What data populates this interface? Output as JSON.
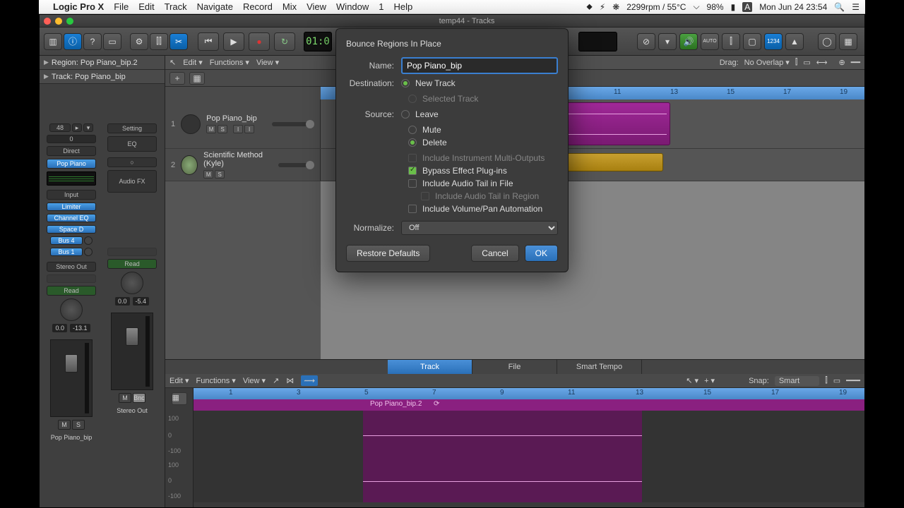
{
  "menubar": {
    "app": "Logic Pro X",
    "items": [
      "File",
      "Edit",
      "Track",
      "Navigate",
      "Record",
      "Mix",
      "View",
      "Window",
      "1",
      "Help"
    ],
    "right": {
      "temp": "2299rpm / 55°C",
      "battery": "98%",
      "date": "Mon Jun 24  23:54"
    }
  },
  "window": {
    "title": "temp44 - Tracks"
  },
  "transport": {
    "time": "01:0"
  },
  "toolbar_num": "1234",
  "inspector": {
    "region_label": "Region:  Pop Piano_bip.2",
    "track_label": "Track:  Pop Piano_bip",
    "strip1": {
      "setting": "Pop Piano",
      "insert1": "Limiter",
      "insert2": "Channel EQ",
      "insert3": "Space D",
      "send1": "Bus 4",
      "send2": "Bus 1",
      "output": "Stereo Out",
      "auto": "Read",
      "db1": "0.0",
      "db2": "-13.1",
      "name": "Pop Piano_bip",
      "midi": "48",
      "direct": "Direct",
      "input": "Input"
    },
    "strip2": {
      "setting": "Setting",
      "eq": "EQ",
      "audiofx": "Audio FX",
      "auto": "Read",
      "db1": "0.0",
      "db2": "-5.4",
      "name": "Stereo Out",
      "bnc": "Bnc"
    }
  },
  "tracks_toolbar": {
    "edit": "Edit",
    "functions": "Functions",
    "view": "View",
    "drag_label": "Drag:",
    "drag_value": "No Overlap"
  },
  "ruler": [
    "11",
    "13",
    "15",
    "17",
    "19"
  ],
  "tracks": [
    {
      "num": "1",
      "name": "Pop Piano_bip",
      "btns": [
        "M",
        "S",
        "I",
        "I"
      ]
    },
    {
      "num": "2",
      "name": "Scientific Method (Kyle)",
      "btns": [
        "M",
        "S"
      ]
    }
  ],
  "editor": {
    "tabs": [
      "Track",
      "File",
      "Smart Tempo"
    ],
    "edit": "Edit",
    "functions": "Functions",
    "view": "View",
    "snap_label": "Snap:",
    "snap_value": "Smart",
    "ruler": [
      "1",
      "3",
      "5",
      "7",
      "9",
      "11",
      "13",
      "15",
      "17",
      "19"
    ],
    "region": "Pop Piano_bip.2",
    "axis": [
      "100",
      "0",
      "-100",
      "100",
      "0",
      "-100"
    ]
  },
  "dialog": {
    "title": "Bounce Regions In Place",
    "name_label": "Name:",
    "name_value": "Pop Piano_bip",
    "dest_label": "Destination:",
    "dest_new": "New Track",
    "dest_sel": "Selected Track",
    "source_label": "Source:",
    "src_leave": "Leave",
    "src_mute": "Mute",
    "src_delete": "Delete",
    "opt_multi": "Include Instrument Multi-Outputs",
    "opt_bypass": "Bypass Effect Plug-ins",
    "opt_tail_file": "Include Audio Tail in File",
    "opt_tail_region": "Include Audio Tail in Region",
    "opt_vol": "Include Volume/Pan Automation",
    "norm_label": "Normalize:",
    "norm_value": "Off",
    "restore": "Restore Defaults",
    "cancel": "Cancel",
    "ok": "OK"
  }
}
